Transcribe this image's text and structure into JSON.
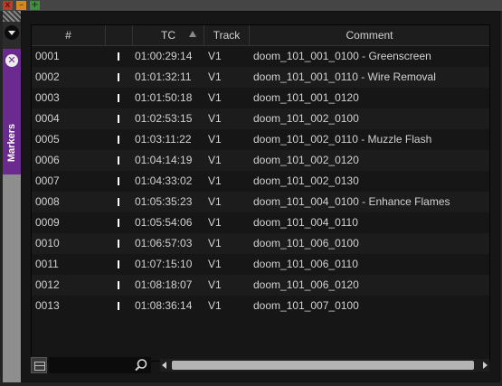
{
  "window": {
    "buttons": {
      "close": "x",
      "minimize": "–",
      "maximize": "+"
    },
    "title": ""
  },
  "sidebar": {
    "tab_close_glyph": "✕",
    "tab_label": "Markers"
  },
  "table": {
    "columns": {
      "number": "#",
      "tc": "TC",
      "track": "Track",
      "comment": "Comment"
    },
    "sort_column": "TC",
    "rows": [
      {
        "num": "0001",
        "tc": "01:00:29:14",
        "track": "V1",
        "comment": "doom_101_001_0100 - Greenscreen"
      },
      {
        "num": "0002",
        "tc": "01:01:32:11",
        "track": "V1",
        "comment": "doom_101_001_0110 - Wire Removal"
      },
      {
        "num": "0003",
        "tc": "01:01:50:18",
        "track": "V1",
        "comment": "doom_101_001_0120"
      },
      {
        "num": "0004",
        "tc": "01:02:53:15",
        "track": "V1",
        "comment": "doom_101_002_0100"
      },
      {
        "num": "0005",
        "tc": "01:03:11:22",
        "track": "V1",
        "comment": "doom_101_002_0110 - Muzzle Flash"
      },
      {
        "num": "0006",
        "tc": "01:04:14:19",
        "track": "V1",
        "comment": "doom_101_002_0120"
      },
      {
        "num": "0007",
        "tc": "01:04:33:02",
        "track": "V1",
        "comment": "doom_101_002_0130"
      },
      {
        "num": "0008",
        "tc": "01:05:35:23",
        "track": "V1",
        "comment": "doom_101_004_0100 - Enhance Flames"
      },
      {
        "num": "0009",
        "tc": "01:05:54:06",
        "track": "V1",
        "comment": "doom_101_004_0110"
      },
      {
        "num": "0010",
        "tc": "01:06:57:03",
        "track": "V1",
        "comment": "doom_101_006_0100"
      },
      {
        "num": "0011",
        "tc": "01:07:15:10",
        "track": "V1",
        "comment": "doom_101_006_0110"
      },
      {
        "num": "0012",
        "tc": "01:08:18:07",
        "track": "V1",
        "comment": "doom_101_006_0120"
      },
      {
        "num": "0013",
        "tc": "01:08:36:14",
        "track": "V1",
        "comment": "doom_101_007_0100"
      }
    ]
  },
  "toolbar": {
    "search_value": "",
    "search_placeholder": "",
    "icons": {
      "view": "list-view-icon",
      "search": "magnifier-icon"
    }
  },
  "colors": {
    "accent_tab": "#6b2a8e",
    "marker_color": "#ffffff",
    "close_button": "#c0392b",
    "minimize_button": "#d28a1f",
    "maximize_button": "#3e8e3e"
  }
}
